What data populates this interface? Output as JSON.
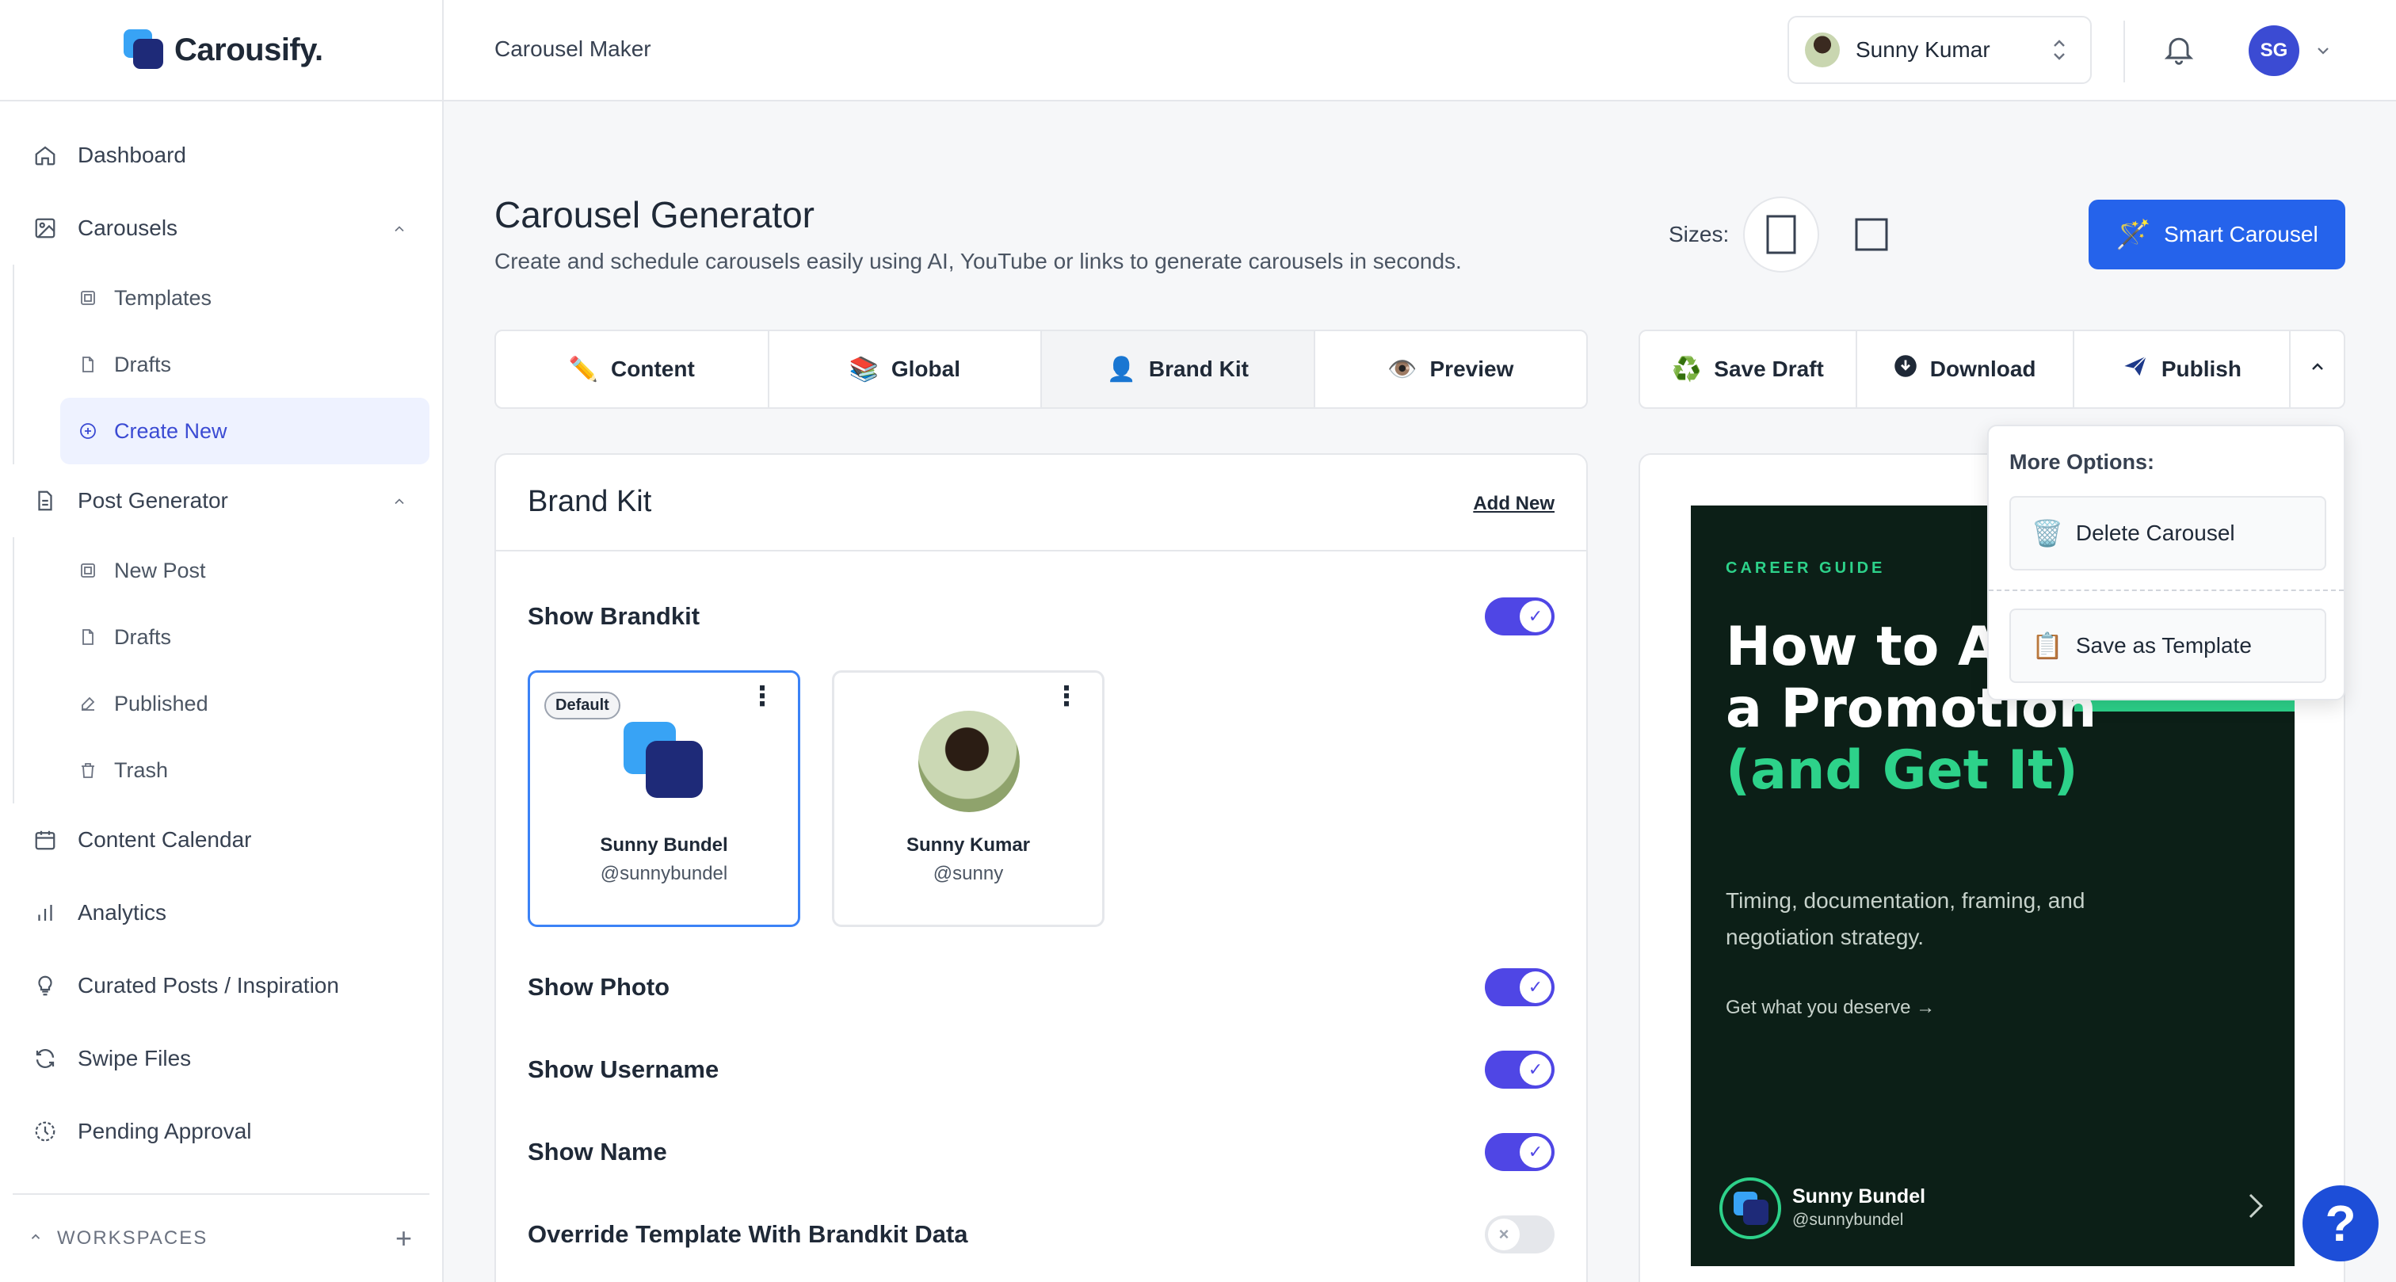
{
  "brand": {
    "name": "Carousify."
  },
  "sidebar": {
    "items": [
      {
        "label": "Dashboard",
        "icon": "home-icon"
      },
      {
        "label": "Carousels",
        "icon": "image-icon",
        "expanded": true,
        "children": [
          {
            "label": "Templates",
            "icon": "template-icon"
          },
          {
            "label": "Drafts",
            "icon": "file-icon"
          },
          {
            "label": "Create New",
            "icon": "plus-circle-icon",
            "active": true
          }
        ]
      },
      {
        "label": "Post Generator",
        "icon": "document-icon",
        "expanded": true,
        "children": [
          {
            "label": "New Post",
            "icon": "template-icon"
          },
          {
            "label": "Drafts",
            "icon": "file-icon"
          },
          {
            "label": "Published",
            "icon": "pen-icon"
          },
          {
            "label": "Trash",
            "icon": "trash-icon"
          }
        ]
      },
      {
        "label": "Content Calendar",
        "icon": "calendar-icon"
      },
      {
        "label": "Analytics",
        "icon": "bar-chart-icon"
      },
      {
        "label": "Curated Posts / Inspiration",
        "icon": "lightbulb-icon"
      },
      {
        "label": "Swipe Files",
        "icon": "refresh-icon"
      },
      {
        "label": "Pending Approval",
        "icon": "clock-icon"
      }
    ],
    "workspaces_label": "WORKSPACES"
  },
  "topbar": {
    "breadcrumb": "Carousel Maker",
    "account_name": "Sunny Kumar",
    "avatar_initials": "SG"
  },
  "main": {
    "title": "Carousel Generator",
    "subtitle": "Create and schedule carousels easily using AI, YouTube or links to generate carousels in seconds.",
    "sizes_label": "Sizes:",
    "smart_button": "Smart Carousel",
    "tabs": [
      {
        "label": "Content",
        "icon": "✏️"
      },
      {
        "label": "Global",
        "icon": "📚"
      },
      {
        "label": "Brand Kit",
        "icon": "👤",
        "active": true
      },
      {
        "label": "Preview",
        "icon": "👁️"
      }
    ],
    "actions": [
      {
        "label": "Save Draft",
        "icon": "♻️"
      },
      {
        "label": "Download",
        "icon": "⬇"
      },
      {
        "label": "Publish",
        "icon": "✈"
      }
    ]
  },
  "brandkit": {
    "title": "Brand Kit",
    "add_new": "Add New",
    "show_brandkit": "Show Brandkit",
    "kits": [
      {
        "name": "Sunny Bundel",
        "handle": "@sunnybundel",
        "default_badge": "Default",
        "selected": true
      },
      {
        "name": "Sunny Kumar",
        "handle": "@sunny",
        "selected": false
      }
    ],
    "toggles": [
      {
        "label": "Show Photo",
        "on": true
      },
      {
        "label": "Show Username",
        "on": true
      },
      {
        "label": "Show Name",
        "on": true
      },
      {
        "label": "Override Template With Brandkit Data",
        "on": false
      }
    ]
  },
  "slide": {
    "kicker": "CAREER GUIDE",
    "title_line1": "How to As",
    "title_line2": "a Promotion",
    "title_line3": "(and Get It)",
    "description": "Timing, documentation, framing, and negotiation strategy.",
    "cta": "Get what you deserve →",
    "author_name": "Sunny Bundel",
    "author_handle": "@sunnybundel",
    "accent_color": "#2dd28a",
    "background_color": "#0c1f17"
  },
  "dropdown": {
    "title": "More Options:",
    "items": [
      {
        "label": "Delete Carousel",
        "icon": "🗑️"
      },
      {
        "label": "Save as Template",
        "icon": "📋"
      }
    ]
  },
  "help": {
    "label": "?"
  },
  "colors": {
    "primary": "#2563eb",
    "toggle": "#4f46e5",
    "active_nav": "#3b4bd3"
  }
}
